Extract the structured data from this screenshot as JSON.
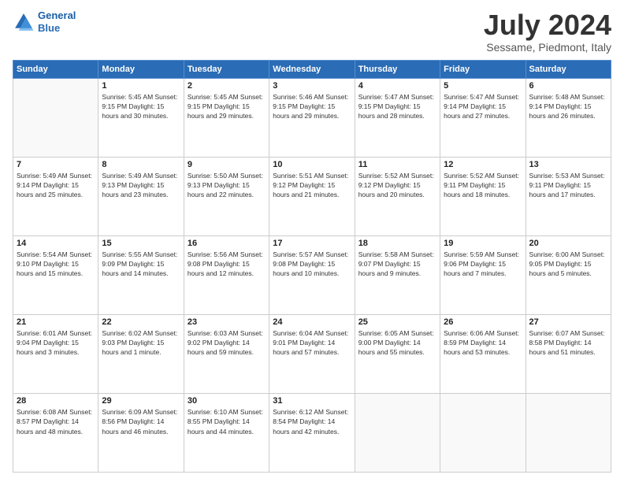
{
  "header": {
    "logo_line1": "General",
    "logo_line2": "Blue",
    "month_title": "July 2024",
    "location": "Sessame, Piedmont, Italy"
  },
  "weekdays": [
    "Sunday",
    "Monday",
    "Tuesday",
    "Wednesday",
    "Thursday",
    "Friday",
    "Saturday"
  ],
  "weeks": [
    [
      {
        "day": "",
        "info": ""
      },
      {
        "day": "1",
        "info": "Sunrise: 5:45 AM\nSunset: 9:15 PM\nDaylight: 15 hours\nand 30 minutes."
      },
      {
        "day": "2",
        "info": "Sunrise: 5:45 AM\nSunset: 9:15 PM\nDaylight: 15 hours\nand 29 minutes."
      },
      {
        "day": "3",
        "info": "Sunrise: 5:46 AM\nSunset: 9:15 PM\nDaylight: 15 hours\nand 29 minutes."
      },
      {
        "day": "4",
        "info": "Sunrise: 5:47 AM\nSunset: 9:15 PM\nDaylight: 15 hours\nand 28 minutes."
      },
      {
        "day": "5",
        "info": "Sunrise: 5:47 AM\nSunset: 9:14 PM\nDaylight: 15 hours\nand 27 minutes."
      },
      {
        "day": "6",
        "info": "Sunrise: 5:48 AM\nSunset: 9:14 PM\nDaylight: 15 hours\nand 26 minutes."
      }
    ],
    [
      {
        "day": "7",
        "info": "Sunrise: 5:49 AM\nSunset: 9:14 PM\nDaylight: 15 hours\nand 25 minutes."
      },
      {
        "day": "8",
        "info": "Sunrise: 5:49 AM\nSunset: 9:13 PM\nDaylight: 15 hours\nand 23 minutes."
      },
      {
        "day": "9",
        "info": "Sunrise: 5:50 AM\nSunset: 9:13 PM\nDaylight: 15 hours\nand 22 minutes."
      },
      {
        "day": "10",
        "info": "Sunrise: 5:51 AM\nSunset: 9:12 PM\nDaylight: 15 hours\nand 21 minutes."
      },
      {
        "day": "11",
        "info": "Sunrise: 5:52 AM\nSunset: 9:12 PM\nDaylight: 15 hours\nand 20 minutes."
      },
      {
        "day": "12",
        "info": "Sunrise: 5:52 AM\nSunset: 9:11 PM\nDaylight: 15 hours\nand 18 minutes."
      },
      {
        "day": "13",
        "info": "Sunrise: 5:53 AM\nSunset: 9:11 PM\nDaylight: 15 hours\nand 17 minutes."
      }
    ],
    [
      {
        "day": "14",
        "info": "Sunrise: 5:54 AM\nSunset: 9:10 PM\nDaylight: 15 hours\nand 15 minutes."
      },
      {
        "day": "15",
        "info": "Sunrise: 5:55 AM\nSunset: 9:09 PM\nDaylight: 15 hours\nand 14 minutes."
      },
      {
        "day": "16",
        "info": "Sunrise: 5:56 AM\nSunset: 9:08 PM\nDaylight: 15 hours\nand 12 minutes."
      },
      {
        "day": "17",
        "info": "Sunrise: 5:57 AM\nSunset: 9:08 PM\nDaylight: 15 hours\nand 10 minutes."
      },
      {
        "day": "18",
        "info": "Sunrise: 5:58 AM\nSunset: 9:07 PM\nDaylight: 15 hours\nand 9 minutes."
      },
      {
        "day": "19",
        "info": "Sunrise: 5:59 AM\nSunset: 9:06 PM\nDaylight: 15 hours\nand 7 minutes."
      },
      {
        "day": "20",
        "info": "Sunrise: 6:00 AM\nSunset: 9:05 PM\nDaylight: 15 hours\nand 5 minutes."
      }
    ],
    [
      {
        "day": "21",
        "info": "Sunrise: 6:01 AM\nSunset: 9:04 PM\nDaylight: 15 hours\nand 3 minutes."
      },
      {
        "day": "22",
        "info": "Sunrise: 6:02 AM\nSunset: 9:03 PM\nDaylight: 15 hours\nand 1 minute."
      },
      {
        "day": "23",
        "info": "Sunrise: 6:03 AM\nSunset: 9:02 PM\nDaylight: 14 hours\nand 59 minutes."
      },
      {
        "day": "24",
        "info": "Sunrise: 6:04 AM\nSunset: 9:01 PM\nDaylight: 14 hours\nand 57 minutes."
      },
      {
        "day": "25",
        "info": "Sunrise: 6:05 AM\nSunset: 9:00 PM\nDaylight: 14 hours\nand 55 minutes."
      },
      {
        "day": "26",
        "info": "Sunrise: 6:06 AM\nSunset: 8:59 PM\nDaylight: 14 hours\nand 53 minutes."
      },
      {
        "day": "27",
        "info": "Sunrise: 6:07 AM\nSunset: 8:58 PM\nDaylight: 14 hours\nand 51 minutes."
      }
    ],
    [
      {
        "day": "28",
        "info": "Sunrise: 6:08 AM\nSunset: 8:57 PM\nDaylight: 14 hours\nand 48 minutes."
      },
      {
        "day": "29",
        "info": "Sunrise: 6:09 AM\nSunset: 8:56 PM\nDaylight: 14 hours\nand 46 minutes."
      },
      {
        "day": "30",
        "info": "Sunrise: 6:10 AM\nSunset: 8:55 PM\nDaylight: 14 hours\nand 44 minutes."
      },
      {
        "day": "31",
        "info": "Sunrise: 6:12 AM\nSunset: 8:54 PM\nDaylight: 14 hours\nand 42 minutes."
      },
      {
        "day": "",
        "info": ""
      },
      {
        "day": "",
        "info": ""
      },
      {
        "day": "",
        "info": ""
      }
    ]
  ]
}
